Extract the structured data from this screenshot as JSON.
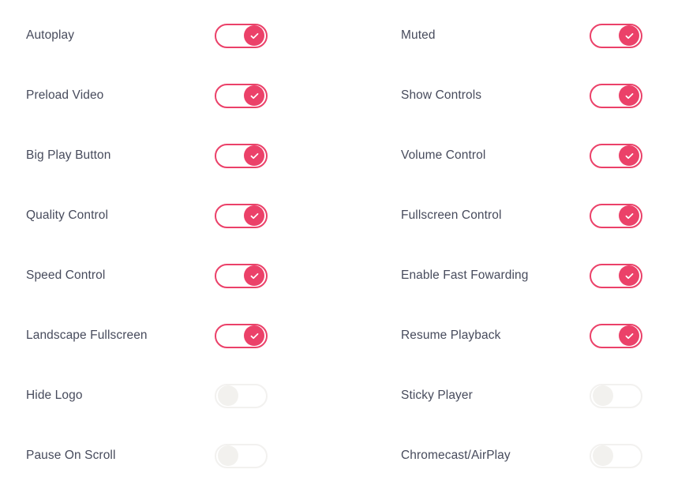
{
  "theme": {
    "background": "#ffffff",
    "label_color": "#474b5c",
    "accent_on": "#eb4169",
    "track_off": "#f2f1ef",
    "knob_off": "#f2f1ee",
    "knob_on_icon_color": "#ffffff"
  },
  "settings": {
    "columns": [
      {
        "name": "left-column",
        "rows": [
          {
            "label": "Autoplay",
            "state": "on",
            "icon": "check-icon"
          },
          {
            "label": "Preload Video",
            "state": "on",
            "icon": "check-icon"
          },
          {
            "label": "Big Play Button",
            "state": "on",
            "icon": "check-icon"
          },
          {
            "label": "Quality Control",
            "state": "on",
            "icon": "check-icon"
          },
          {
            "label": "Speed Control",
            "state": "on",
            "icon": "check-icon"
          },
          {
            "label": "Landscape Fullscreen",
            "state": "on",
            "icon": "check-icon"
          },
          {
            "label": "Hide Logo",
            "state": "off",
            "icon": ""
          },
          {
            "label": "Pause On Scroll",
            "state": "off",
            "icon": ""
          }
        ]
      },
      {
        "name": "right-column",
        "rows": [
          {
            "label": "Muted",
            "state": "on",
            "icon": "check-icon"
          },
          {
            "label": "Show Controls",
            "state": "on",
            "icon": "check-icon"
          },
          {
            "label": "Volume Control",
            "state": "on",
            "icon": "check-icon"
          },
          {
            "label": "Fullscreen Control",
            "state": "on",
            "icon": "check-icon"
          },
          {
            "label": "Enable Fast Fowarding",
            "state": "on",
            "icon": "check-icon"
          },
          {
            "label": "Resume Playback",
            "state": "on",
            "icon": "check-icon"
          },
          {
            "label": "Sticky Player",
            "state": "off",
            "icon": ""
          },
          {
            "label": "Chromecast/AirPlay",
            "state": "off",
            "icon": ""
          }
        ]
      }
    ]
  }
}
